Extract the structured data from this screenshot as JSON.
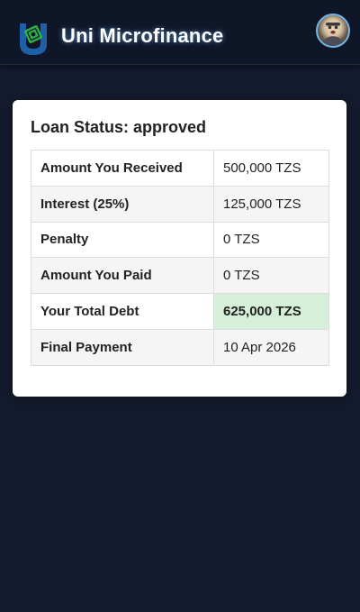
{
  "header": {
    "app_title": "Uni Microfinance",
    "logo_icon": "money-shield-logo-icon",
    "avatar_icon": "user-avatar-icon"
  },
  "loan": {
    "status_title": "Loan Status: approved",
    "rows": [
      {
        "label": "Amount You Received",
        "value": "500,000 TZS"
      },
      {
        "label": "Interest (25%)",
        "value": "125,000 TZS"
      },
      {
        "label": "Penalty",
        "value": "0 TZS"
      },
      {
        "label": "Amount You Paid",
        "value": "0 TZS"
      },
      {
        "label": "Your Total Debt",
        "value": "625,000 TZS"
      },
      {
        "label": "Final Payment",
        "value": "10 Apr 2026"
      }
    ]
  },
  "colors": {
    "background": "#131a2d",
    "header": "#0f1628",
    "highlight": "#d6efd9",
    "logo_blue": "#1e5fa8",
    "logo_green": "#2fae4a"
  }
}
